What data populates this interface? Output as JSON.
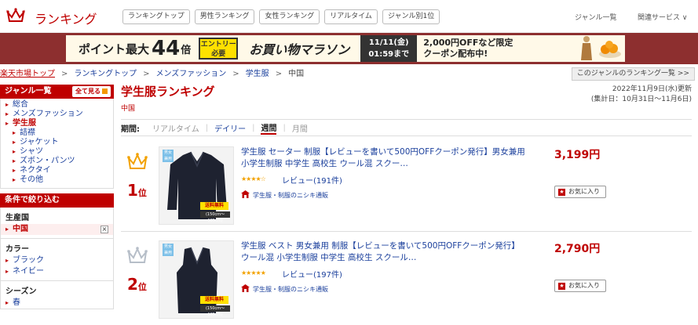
{
  "header": {
    "logo_text": "ランキング",
    "tabs": [
      "ランキングトップ",
      "男性ランキング",
      "女性ランキング",
      "リアルタイム",
      "ジャンル別1位"
    ],
    "genre_list": "ジャンル一覧",
    "related": "関連サービス ∨"
  },
  "banner": {
    "point_text": "ポイント最大",
    "point_num": "44",
    "point_unit": "倍",
    "entry_line1": "エントリー",
    "entry_line2": "必要",
    "marathon": "お買い物マラソン",
    "date_line1": "11/11(金)",
    "date_line2": "01:59まで",
    "coupon_line1": "2,000円OFFなど限定",
    "coupon_line2": "クーポン配布中!"
  },
  "breadcrumb": [
    "楽天市場トップ",
    "ランキングトップ",
    "メンズファッション",
    "学生服",
    "中国"
  ],
  "genre_ranking_list_btn": "このジャンルのランキング一覧 >>",
  "sidebar": {
    "genre_head": "ジャンル一覧",
    "see_all": "全て見る",
    "items": [
      {
        "label": "総合",
        "level": 0
      },
      {
        "label": "メンズファッション",
        "level": 0
      },
      {
        "label": "学生服",
        "level": 0,
        "active": true
      },
      {
        "label": "詰襟",
        "level": 1
      },
      {
        "label": "ジャケット",
        "level": 1
      },
      {
        "label": "シャツ",
        "level": 1
      },
      {
        "label": "ズボン・パンツ",
        "level": 1
      },
      {
        "label": "ネクタイ",
        "level": 1
      },
      {
        "label": "その他",
        "level": 1
      }
    ],
    "filter_head": "条件で絞り込む",
    "filters": {
      "origin_title": "生産国",
      "origin_selected": "中国",
      "color_title": "カラー",
      "colors": [
        "ブラック",
        "ネイビー"
      ],
      "season_title": "シーズン",
      "seasons": [
        "春"
      ]
    }
  },
  "main": {
    "title": "学生服ランキング",
    "subtitle": "中国",
    "updated": "2022年11月9日(水)更新",
    "period_range": "(集計日：10月31日〜11月6日)",
    "period_label": "期間:",
    "period_options": [
      "リアルタイム",
      "デイリー",
      "週間",
      "月間"
    ]
  },
  "items": [
    {
      "rank": "1",
      "rank_unit": "位",
      "title": "学生服 セーター 制服【レビューを書いて500円OFFクーポン発行】男女兼用 小学生制服 中学生 高校生 ウール混 スクー…",
      "stars": "★★★★☆",
      "review": "レビュー(191件)",
      "shop": "学生服・制服のニシキ通販",
      "price": "3,199円",
      "fav": "お気に入り",
      "free_ship": "送料無料",
      "thumb_tag": "男女兼用",
      "thumb_note": "(150cm〜185cm)"
    },
    {
      "rank": "2",
      "rank_unit": "位",
      "title": "学生服 ベスト 男女兼用 制服【レビューを書いて500円OFFクーポン発行】ウール混 小学生制服 中学生 高校生 スクール…",
      "stars": "★★★★★",
      "review": "レビュー(197件)",
      "shop": "学生服・制服のニシキ通販",
      "price": "2,790円",
      "fav": "お気に入り",
      "free_ship": "送料無料",
      "thumb_tag": "男女兼用",
      "thumb_note": "(150cm〜185cm)"
    }
  ],
  "colors": {
    "brand_red": "#bf0000",
    "link_blue": "#1a3f9c",
    "gold": "#f2a100",
    "silver": "#b6bec8"
  }
}
